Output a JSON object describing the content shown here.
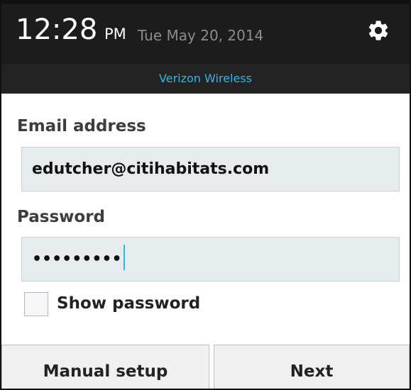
{
  "status_bar": {
    "time": "12:28",
    "ampm": "PM",
    "date": "Tue May 20, 2014",
    "settings_icon": "gear-icon",
    "carrier": "Verizon Wireless",
    "carrier_color": "#34b5e5"
  },
  "form": {
    "email_label": "Email address",
    "email_value": "edutcher@citihabitats.com",
    "password_label": "Password",
    "password_value": "•••••••••",
    "show_password_label": "Show password",
    "show_password_checked": false,
    "accent_color": "#33b5e5"
  },
  "buttons": {
    "manual_setup": "Manual setup",
    "next": "Next"
  }
}
